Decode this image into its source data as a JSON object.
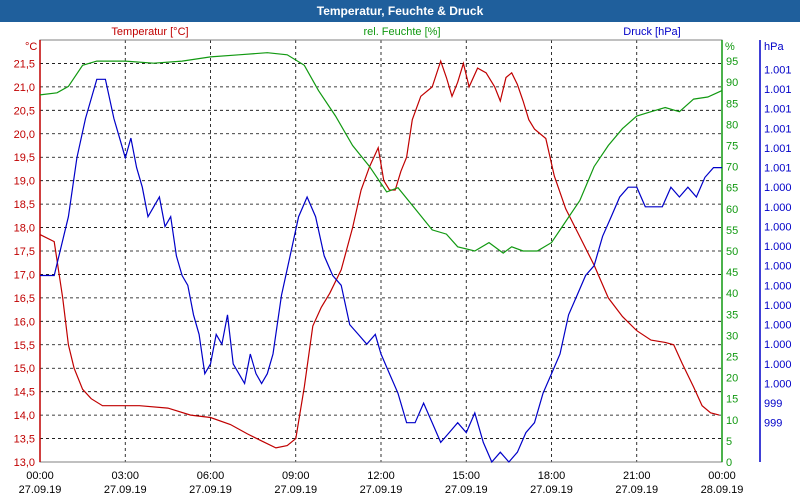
{
  "window": {
    "title": "Temperatur, Feuchte & Druck"
  },
  "colors": {
    "temperature": "#c00000",
    "humidity": "#119911",
    "pressure": "#0000c8",
    "titlebar": "#1f5f9c"
  },
  "chart_data": {
    "type": "line",
    "title": "Temperatur, Feuchte & Druck",
    "grid": true,
    "x_ticks": [
      {
        "hours": 0,
        "time": "00:00",
        "date": "27.09.19"
      },
      {
        "hours": 3,
        "time": "03:00",
        "date": "27.09.19"
      },
      {
        "hours": 6,
        "time": "06:00",
        "date": "27.09.19"
      },
      {
        "hours": 9,
        "time": "09:00",
        "date": "27.09.19"
      },
      {
        "hours": 12,
        "time": "12:00",
        "date": "27.09.19"
      },
      {
        "hours": 15,
        "time": "15:00",
        "date": "27.09.19"
      },
      {
        "hours": 18,
        "time": "18:00",
        "date": "27.09.19"
      },
      {
        "hours": 21,
        "time": "21:00",
        "date": "27.09.19"
      },
      {
        "hours": 24,
        "time": "00:00",
        "date": "28.09.19"
      }
    ],
    "axes": {
      "temperature": {
        "label": "Temperatur [°C]",
        "unit": "°C",
        "min": 13.0,
        "max": 22.0,
        "ticks": [
          "13,0",
          "13,5",
          "14,0",
          "14,5",
          "15,0",
          "15,5",
          "16,0",
          "16,5",
          "17,0",
          "17,5",
          "18,0",
          "18,5",
          "19,0",
          "19,5",
          "20,0",
          "20,5",
          "21,0",
          "21,5"
        ]
      },
      "humidity": {
        "label": "rel. Feuchte [%]",
        "unit": "%",
        "min": 0,
        "max": 100,
        "ticks": [
          "0",
          "5",
          "10",
          "15",
          "20",
          "25",
          "30",
          "35",
          "40",
          "45",
          "50",
          "55",
          "60",
          "65",
          "70",
          "75",
          "80",
          "85",
          "90",
          "95"
        ]
      },
      "pressure": {
        "label": "Druck [hPa]",
        "unit": "hPa",
        "min": 999.55,
        "max": 1001.7,
        "ticks": [
          {
            "v": 999.75,
            "t": "999"
          },
          {
            "v": 999.85,
            "t": "999"
          },
          {
            "v": 999.95,
            "t": "1.000"
          },
          {
            "v": 1000.05,
            "t": "1.000"
          },
          {
            "v": 1000.15,
            "t": "1.000"
          },
          {
            "v": 1000.25,
            "t": "1.000"
          },
          {
            "v": 1000.35,
            "t": "1.000"
          },
          {
            "v": 1000.45,
            "t": "1.000"
          },
          {
            "v": 1000.55,
            "t": "1.000"
          },
          {
            "v": 1000.65,
            "t": "1.000"
          },
          {
            "v": 1000.75,
            "t": "1.000"
          },
          {
            "v": 1000.85,
            "t": "1.000"
          },
          {
            "v": 1000.95,
            "t": "1.000"
          },
          {
            "v": 1001.05,
            "t": "1.001"
          },
          {
            "v": 1001.15,
            "t": "1.001"
          },
          {
            "v": 1001.25,
            "t": "1.001"
          },
          {
            "v": 1001.35,
            "t": "1.001"
          },
          {
            "v": 1001.45,
            "t": "1.001"
          },
          {
            "v": 1001.55,
            "t": "1.001"
          }
        ]
      }
    },
    "series": [
      {
        "name": "Temperatur [°C]",
        "axis": "temperature",
        "x": [
          0,
          0.5,
          0.8,
          1.0,
          1.2,
          1.5,
          1.8,
          2.2,
          2.7,
          3.5,
          4.5,
          5.3,
          6.0,
          6.7,
          7.3,
          7.8,
          8.3,
          8.7,
          9.0,
          9.3,
          9.6,
          9.9,
          10.2,
          10.6,
          11.0,
          11.3,
          11.6,
          11.9,
          12.1,
          12.3,
          12.5,
          12.7,
          12.9,
          13.1,
          13.4,
          13.8,
          14.1,
          14.3,
          14.5,
          14.7,
          14.9,
          15.1,
          15.4,
          15.7,
          16.0,
          16.2,
          16.4,
          16.6,
          16.8,
          17.0,
          17.2,
          17.4,
          17.8,
          18.1,
          18.5,
          19.0,
          19.5,
          20.0,
          20.5,
          21.0,
          21.5,
          22.0,
          22.3,
          22.6,
          23.0,
          23.3,
          23.6,
          23.9
        ],
        "values": [
          17.85,
          17.7,
          16.5,
          15.5,
          15.0,
          14.55,
          14.35,
          14.2,
          14.2,
          14.2,
          14.15,
          14.0,
          13.95,
          13.8,
          13.6,
          13.45,
          13.3,
          13.35,
          13.5,
          14.6,
          15.9,
          16.3,
          16.6,
          17.1,
          18.0,
          18.8,
          19.3,
          19.7,
          19.0,
          18.8,
          18.8,
          19.2,
          19.5,
          20.3,
          20.8,
          21.0,
          21.55,
          21.2,
          20.8,
          21.1,
          21.5,
          21.0,
          21.4,
          21.3,
          21.0,
          20.7,
          21.2,
          21.3,
          21.05,
          20.7,
          20.3,
          20.1,
          19.9,
          19.1,
          18.4,
          17.8,
          17.2,
          16.5,
          16.1,
          15.8,
          15.6,
          15.55,
          15.5,
          15.1,
          14.6,
          14.2,
          14.05,
          14.0
        ]
      },
      {
        "name": "rel. Feuchte [%]",
        "axis": "humidity",
        "x": [
          0,
          0.6,
          1.0,
          1.5,
          2.0,
          3.0,
          4.0,
          5.0,
          6.0,
          7.0,
          8.0,
          8.7,
          9.3,
          9.8,
          10.4,
          11.0,
          11.6,
          12.2,
          12.6,
          13.2,
          13.8,
          14.3,
          14.7,
          15.3,
          15.8,
          16.3,
          16.6,
          17.0,
          17.5,
          18.0,
          18.5,
          19.0,
          19.5,
          20.0,
          20.5,
          21.0,
          21.5,
          22.0,
          22.5,
          23.0,
          23.5,
          24.0
        ],
        "values": [
          87,
          87.5,
          89,
          94,
          95,
          95,
          94.5,
          95,
          96,
          96.5,
          97,
          96.5,
          94,
          88,
          82,
          75,
          70,
          64,
          65,
          60,
          55,
          54,
          51,
          50,
          52,
          49.5,
          51,
          50,
          50,
          52,
          57,
          62,
          70,
          75,
          79,
          82,
          83,
          84,
          83,
          86,
          86.5,
          88
        ]
      },
      {
        "name": "Druck [hPa]",
        "axis": "pressure",
        "x": [
          0,
          0.5,
          1.0,
          1.3,
          1.6,
          2.0,
          2.3,
          2.6,
          2.8,
          3.0,
          3.2,
          3.4,
          3.6,
          3.8,
          4.0,
          4.2,
          4.4,
          4.6,
          4.8,
          5.0,
          5.2,
          5.4,
          5.6,
          5.8,
          6.0,
          6.2,
          6.4,
          6.6,
          6.8,
          7.0,
          7.2,
          7.4,
          7.6,
          7.8,
          8.0,
          8.2,
          8.5,
          8.8,
          9.1,
          9.4,
          9.7,
          10.0,
          10.3,
          10.6,
          10.9,
          11.2,
          11.5,
          11.8,
          12.0,
          12.3,
          12.6,
          12.9,
          13.2,
          13.5,
          13.8,
          14.1,
          14.4,
          14.7,
          15.0,
          15.3,
          15.6,
          15.9,
          16.2,
          16.5,
          16.8,
          17.1,
          17.4,
          17.7,
          18.0,
          18.3,
          18.6,
          18.9,
          19.2,
          19.5,
          19.8,
          20.1,
          20.4,
          20.7,
          21.0,
          21.3,
          21.6,
          21.9,
          22.2,
          22.5,
          22.8,
          23.1,
          23.4,
          23.7,
          24.0
        ],
        "values": [
          1000.5,
          1000.5,
          1000.8,
          1001.1,
          1001.3,
          1001.5,
          1001.5,
          1001.3,
          1001.2,
          1001.1,
          1001.2,
          1001.05,
          1000.95,
          1000.8,
          1000.85,
          1000.9,
          1000.75,
          1000.8,
          1000.6,
          1000.5,
          1000.45,
          1000.3,
          1000.2,
          1000.0,
          1000.05,
          1000.2,
          1000.15,
          1000.3,
          1000.05,
          1000.0,
          999.95,
          1000.1,
          1000.0,
          999.95,
          1000.0,
          1000.1,
          1000.4,
          1000.6,
          1000.8,
          1000.9,
          1000.8,
          1000.6,
          1000.5,
          1000.45,
          1000.25,
          1000.2,
          1000.15,
          1000.2,
          1000.1,
          1000.0,
          999.9,
          999.75,
          999.75,
          999.85,
          999.75,
          999.65,
          999.7,
          999.75,
          999.7,
          999.8,
          999.65,
          999.55,
          999.6,
          999.55,
          999.6,
          999.7,
          999.75,
          999.9,
          1000.0,
          1000.1,
          1000.3,
          1000.4,
          1000.5,
          1000.55,
          1000.7,
          1000.8,
          1000.9,
          1000.95,
          1000.95,
          1000.85,
          1000.85,
          1000.85,
          1000.95,
          1000.9,
          1000.95,
          1000.9,
          1001.0,
          1001.05,
          1001.05
        ]
      }
    ]
  }
}
